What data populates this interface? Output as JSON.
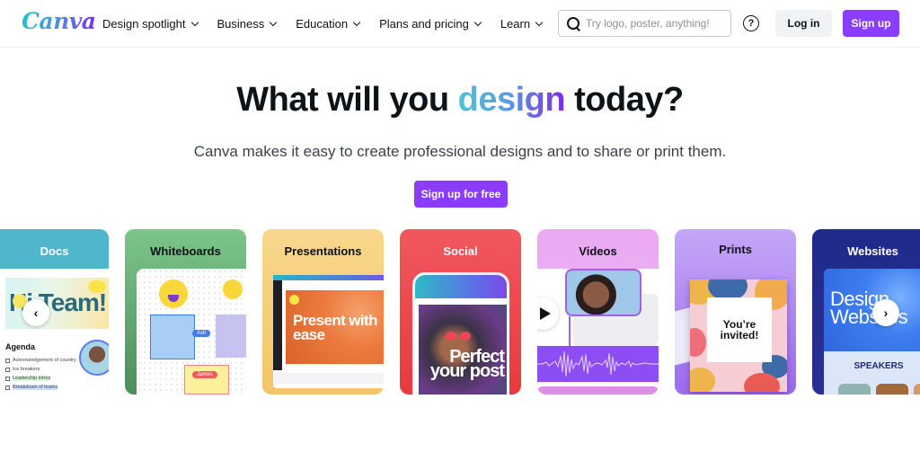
{
  "header": {
    "logo": "Canva",
    "nav": [
      {
        "label": "Design spotlight"
      },
      {
        "label": "Business"
      },
      {
        "label": "Education"
      },
      {
        "label": "Plans and pricing"
      },
      {
        "label": "Learn"
      }
    ],
    "search": {
      "placeholder": "Try logo, poster, anything!",
      "value": ""
    },
    "help_icon": "?",
    "login_label": "Log in",
    "signup_label": "Sign up"
  },
  "hero": {
    "title_prefix": "What will you ",
    "title_highlight": "design",
    "title_suffix": " today?",
    "subtitle": "Canva makes it easy to create professional designs and to share or print them.",
    "cta_label": "Sign up for free"
  },
  "colors": {
    "brand_purple": "#8b3dff",
    "text_dark": "#0e1318"
  },
  "carousel": {
    "prev_icon": "‹",
    "next_icon": "›",
    "cards": [
      {
        "title": "Docs",
        "banner_text": "Hi Team!",
        "agenda_title": "Agenda",
        "agenda_items": [
          "Acknowledgement of country",
          "Ice breakers",
          "Leadership intros",
          "Breakdown of teams"
        ]
      },
      {
        "title": "Whiteboards",
        "tags": [
          "Ash",
          "James"
        ]
      },
      {
        "title": "Presentations",
        "slide_text": "Present with ease"
      },
      {
        "title": "Social",
        "post_text": "Perfect your post"
      },
      {
        "title": "Videos"
      },
      {
        "title": "Prints",
        "card_text": "You’re invited!"
      },
      {
        "title": "Websites",
        "hero_text": "Design Websites",
        "section_label": "SPEAKERS"
      }
    ]
  }
}
